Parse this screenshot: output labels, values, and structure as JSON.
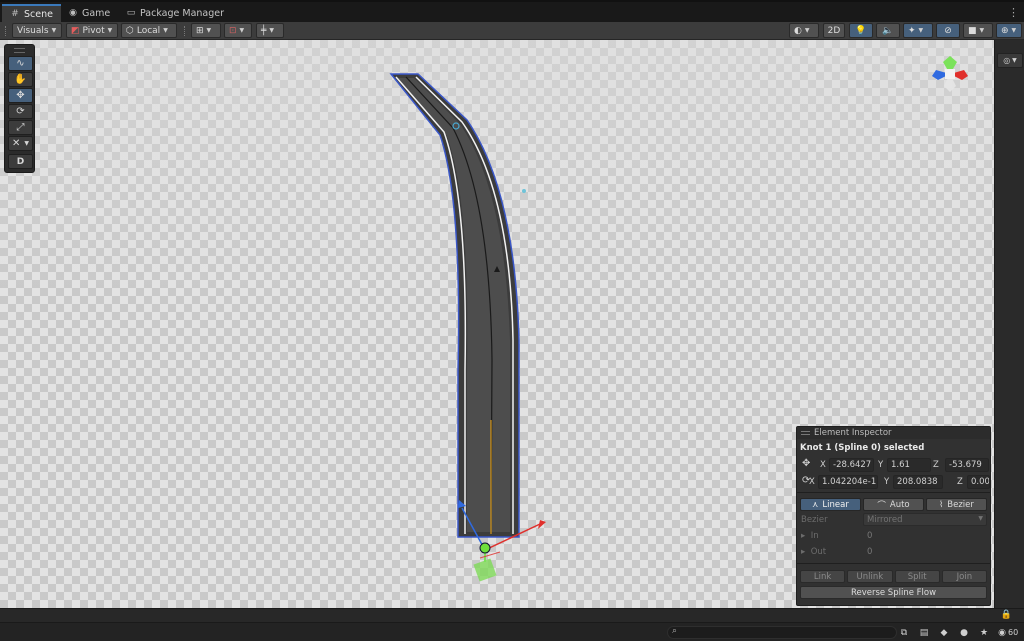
{
  "tabs": [
    {
      "label": "Scene",
      "icon": "grid-icon",
      "active": true
    },
    {
      "label": "Game",
      "icon": "gamepad-icon",
      "active": false
    },
    {
      "label": "Package Manager",
      "icon": "package-icon",
      "active": false
    }
  ],
  "toolbar": {
    "visuals_label": "Visuals",
    "pivot_label": "Pivot",
    "local_label": "Local",
    "mode_2d_label": "2D"
  },
  "tool_palette": {
    "items": [
      "spline-draw-icon",
      "hand-icon",
      "move-icon",
      "rotate-icon",
      "scale-icon",
      "settings-icon"
    ],
    "d_label": "D",
    "selected": "move-icon"
  },
  "inspector": {
    "header": "Element Inspector",
    "title": "Knot 1 (Spline 0) selected",
    "position": {
      "x_label": "X",
      "x": "-28.6427",
      "y_label": "Y",
      "y": "1.61",
      "z_label": "Z",
      "z": "-53.679"
    },
    "rotation": {
      "x_label": "X",
      "x": "1.042204e-1(",
      "y_label": "Y",
      "y": "208.0838",
      "z_label": "Z",
      "z": "0.00"
    },
    "modes": [
      {
        "label": "Linear",
        "selected": true
      },
      {
        "label": "Auto",
        "selected": false
      },
      {
        "label": "Bezier",
        "selected": false
      }
    ],
    "bezier": {
      "label": "Bezier",
      "value": "Mirrored"
    },
    "in": {
      "label": "In",
      "value": "0"
    },
    "out": {
      "label": "Out",
      "value": "0"
    },
    "actions": [
      "Link",
      "Unlink",
      "Split",
      "Join"
    ],
    "reverse_label": "Reverse Spline Flow"
  },
  "status": {
    "fps_label": "60"
  },
  "colors": {
    "accent": "#3a79bb",
    "selected_button": "#46607c",
    "panel": "#313131"
  }
}
